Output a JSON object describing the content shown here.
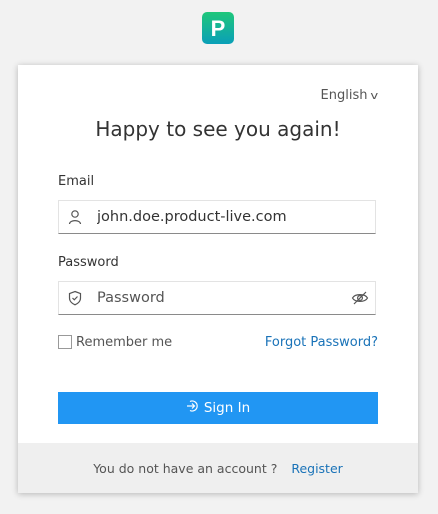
{
  "brand": {
    "logo_letter": "P",
    "logo_color_top": "#19c37d",
    "logo_color_bottom": "#0aa7b5"
  },
  "language": {
    "label": "English",
    "chevron": "v"
  },
  "title": "Happy to see you again!",
  "email": {
    "label": "Email",
    "value": "john.doe.product-live.com",
    "icon": "user-icon"
  },
  "password": {
    "label": "Password",
    "placeholder": "Password",
    "icon": "shield-icon",
    "toggle_icon": "eye-slash-icon"
  },
  "remember_me": {
    "label": "Remember me",
    "checked": false
  },
  "forgot_password": "Forgot Password?",
  "sign_in": {
    "label": "Sign In",
    "icon": "sign-in-icon",
    "color": "#2196f3"
  },
  "footer": {
    "prompt": "You do not have an account ?",
    "register_label": "Register"
  }
}
